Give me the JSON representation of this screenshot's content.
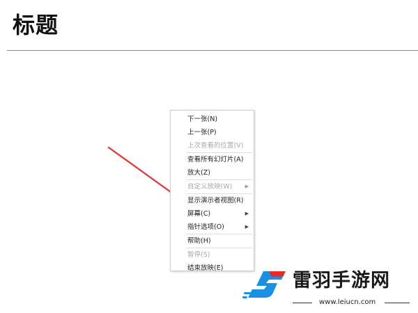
{
  "document": {
    "title": "标题"
  },
  "context_menu": {
    "items": [
      {
        "label": "下一张(N)",
        "disabled": false,
        "submenu": false
      },
      {
        "label": "上一张(P)",
        "disabled": false,
        "submenu": false
      },
      {
        "label": "上次查看的位置(V)",
        "disabled": true,
        "submenu": false
      },
      {
        "label": "查看所有幻灯片(A)",
        "disabled": false,
        "submenu": false
      },
      {
        "label": "放大(Z)",
        "disabled": false,
        "submenu": false
      },
      {
        "label": "自定义放映(W)",
        "disabled": true,
        "submenu": true
      },
      {
        "label": "显示演示者视图(R)",
        "disabled": false,
        "submenu": false
      },
      {
        "label": "屏幕(C)",
        "disabled": false,
        "submenu": true
      },
      {
        "label": "指针选项(O)",
        "disabled": false,
        "submenu": true
      },
      {
        "label": "帮助(H)",
        "disabled": false,
        "submenu": false
      },
      {
        "label": "暂停(S)",
        "disabled": true,
        "submenu": false
      },
      {
        "label": "结束放映(E)",
        "disabled": false,
        "submenu": false
      }
    ]
  },
  "watermark": {
    "brand": "雷羽手游网",
    "url": "www.leiucn.com",
    "colors": {
      "blue": "#1b8fe0",
      "red": "#e52a2a"
    }
  },
  "annotation": {
    "arrow_color": "#d9443f"
  }
}
